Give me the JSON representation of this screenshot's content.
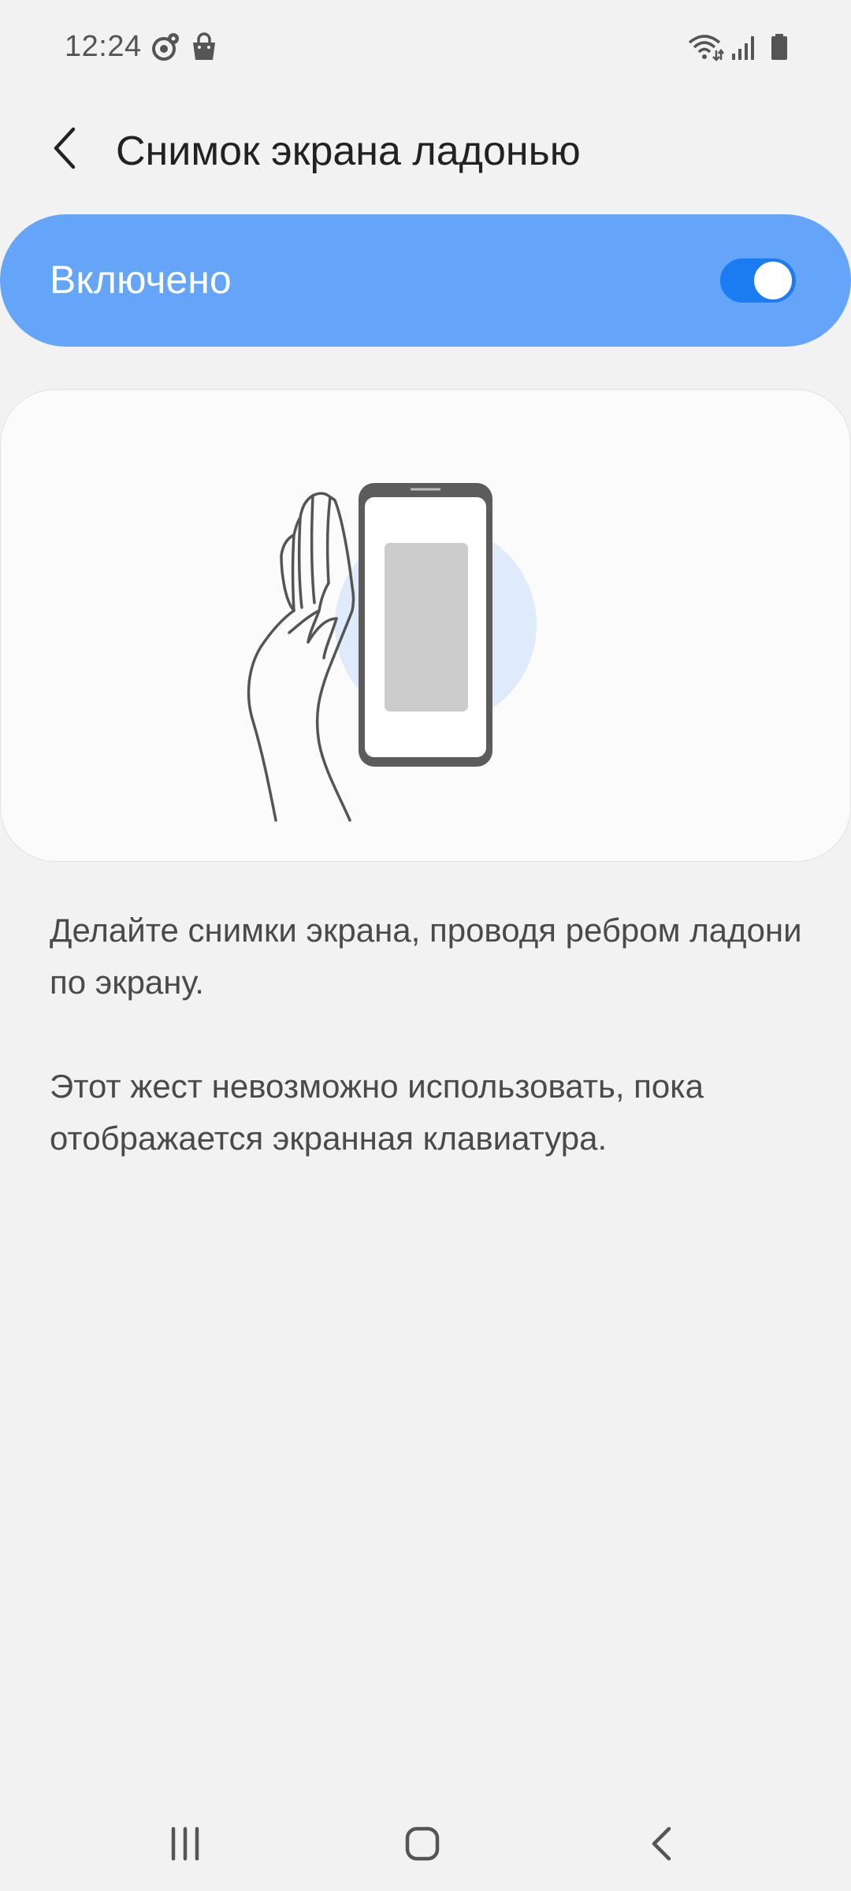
{
  "status_bar": {
    "time": "12:24",
    "icons": [
      "location-target-icon",
      "shopping-bag-icon",
      "wifi-icon",
      "signal-icon",
      "battery-icon"
    ]
  },
  "app_bar": {
    "title": "Снимок экрана ладонью",
    "back_icon": "chevron-left-icon"
  },
  "master_switch": {
    "label": "Включено",
    "state": "on",
    "accent_color": "#64a4f9"
  },
  "illustration": {
    "icon": "palm-swipe-phone-illustration"
  },
  "descriptions": [
    "Делайте снимки экрана, проводя ребром ладони по экрану.",
    "Этот жест невозможно использовать, пока отображается экранная клавиатура."
  ],
  "nav_bar": {
    "buttons": [
      "recent-apps-icon",
      "home-icon",
      "back-icon"
    ]
  }
}
